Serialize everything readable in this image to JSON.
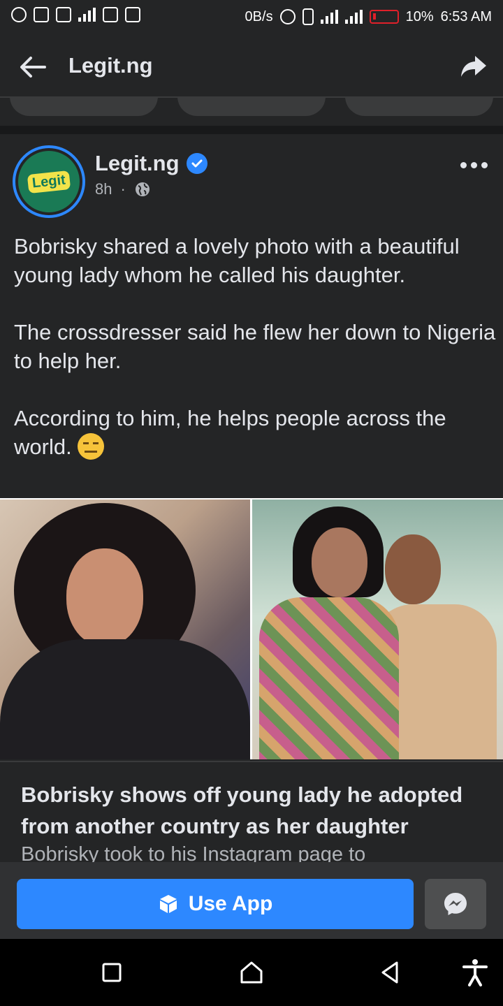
{
  "status_bar": {
    "net_speed": "0B/s",
    "battery": "10%",
    "time": "6:53 AM"
  },
  "appbar": {
    "title": "Legit.ng"
  },
  "post": {
    "avatar_logo": "Legit",
    "page_name": "Legit.ng",
    "time_ago": "8h",
    "separator": "·",
    "paragraphs": [
      "Bobrisky shared a lovely photo with a beautiful young lady whom he called his daughter.",
      "The crossdresser said he flew her down to Nigeria to help her.",
      "According to him, he helps people across the world."
    ],
    "link": {
      "title": "Bobrisky shows off young lady he adopted from another country as her daughter",
      "description": "Bobrisky took to his Instagram page to"
    }
  },
  "bottom_bar": {
    "use_app_label": "Use App"
  },
  "colors": {
    "background": "#242526",
    "accent": "#2d88ff",
    "battery_low": "#e0202a"
  },
  "icons": [
    "back-arrow-icon",
    "share-icon",
    "verified-icon",
    "globe-icon",
    "more-icon",
    "cube-icon",
    "messenger-icon",
    "recent-apps-icon",
    "home-icon",
    "back-icon",
    "accessibility-icon"
  ]
}
